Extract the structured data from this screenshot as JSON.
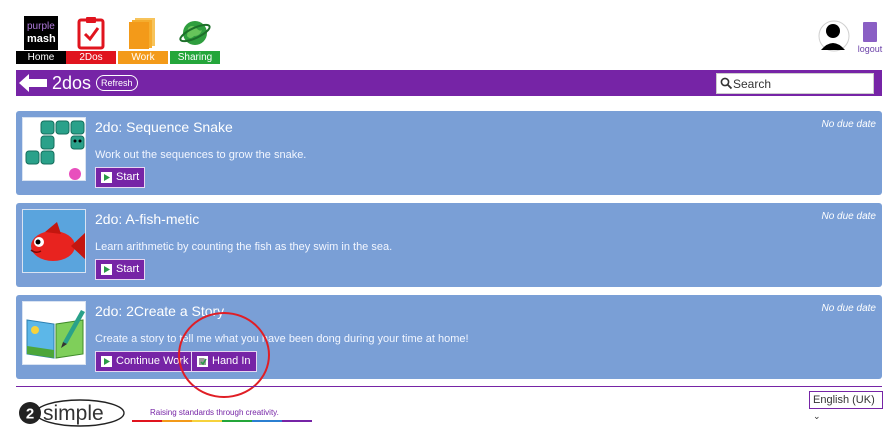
{
  "nav": {
    "home_label": "Home",
    "twodos_label": "2Dos",
    "work_label": "Work",
    "sharing_label": "Sharing",
    "logo_line1": "purple",
    "logo_line2": "mash",
    "logout_label": "logout"
  },
  "header": {
    "title": "2dos",
    "refresh_label": "Refresh",
    "search_placeholder": "Search"
  },
  "todos": [
    {
      "title": "2do: Sequence Snake",
      "due": "No due date",
      "description": "Work out the sequences to grow the snake.",
      "buttons": [
        "Start"
      ]
    },
    {
      "title": "2do: A-fish-metic",
      "due": "No due date",
      "description": "Learn arithmetic by counting the fish as they swim in the sea.",
      "buttons": [
        "Start"
      ]
    },
    {
      "title": "2do: 2Create a Story",
      "due": "No due date",
      "description": "Create a story to tell me what you have been dong during your time at home!",
      "buttons": [
        "Continue Work",
        "Hand In"
      ]
    }
  ],
  "footer": {
    "brand_digit": "2",
    "brand_word": "simple",
    "tagline": "Raising standards through creativity.",
    "language": "English (UK)"
  },
  "colors": {
    "purple": "#7624a6",
    "card_blue": "#7a9fd6",
    "annotation_red": "#e01e25"
  },
  "icons": [
    "purple-mash-logo",
    "checklist-icon",
    "folder-icon",
    "globe-icon",
    "avatar-icon",
    "door-icon",
    "back-arrow-icon",
    "search-icon",
    "start-icon",
    "hand-in-icon"
  ]
}
